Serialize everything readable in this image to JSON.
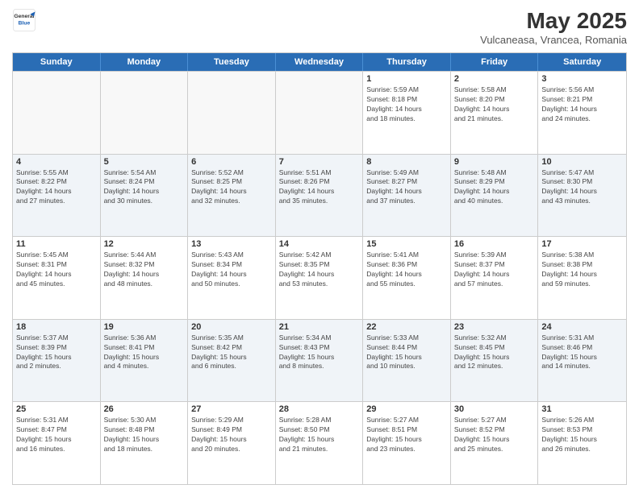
{
  "logo": {
    "general": "General",
    "blue": "Blue"
  },
  "title": "May 2025",
  "subtitle": "Vulcaneasa, Vrancea, Romania",
  "header_days": [
    "Sunday",
    "Monday",
    "Tuesday",
    "Wednesday",
    "Thursday",
    "Friday",
    "Saturday"
  ],
  "rows": [
    [
      {
        "day": "",
        "info": "",
        "empty": true
      },
      {
        "day": "",
        "info": "",
        "empty": true
      },
      {
        "day": "",
        "info": "",
        "empty": true
      },
      {
        "day": "",
        "info": "",
        "empty": true
      },
      {
        "day": "1",
        "info": "Sunrise: 5:59 AM\nSunset: 8:18 PM\nDaylight: 14 hours\nand 18 minutes.",
        "empty": false
      },
      {
        "day": "2",
        "info": "Sunrise: 5:58 AM\nSunset: 8:20 PM\nDaylight: 14 hours\nand 21 minutes.",
        "empty": false
      },
      {
        "day": "3",
        "info": "Sunrise: 5:56 AM\nSunset: 8:21 PM\nDaylight: 14 hours\nand 24 minutes.",
        "empty": false
      }
    ],
    [
      {
        "day": "4",
        "info": "Sunrise: 5:55 AM\nSunset: 8:22 PM\nDaylight: 14 hours\nand 27 minutes.",
        "empty": false
      },
      {
        "day": "5",
        "info": "Sunrise: 5:54 AM\nSunset: 8:24 PM\nDaylight: 14 hours\nand 30 minutes.",
        "empty": false
      },
      {
        "day": "6",
        "info": "Sunrise: 5:52 AM\nSunset: 8:25 PM\nDaylight: 14 hours\nand 32 minutes.",
        "empty": false
      },
      {
        "day": "7",
        "info": "Sunrise: 5:51 AM\nSunset: 8:26 PM\nDaylight: 14 hours\nand 35 minutes.",
        "empty": false
      },
      {
        "day": "8",
        "info": "Sunrise: 5:49 AM\nSunset: 8:27 PM\nDaylight: 14 hours\nand 37 minutes.",
        "empty": false
      },
      {
        "day": "9",
        "info": "Sunrise: 5:48 AM\nSunset: 8:29 PM\nDaylight: 14 hours\nand 40 minutes.",
        "empty": false
      },
      {
        "day": "10",
        "info": "Sunrise: 5:47 AM\nSunset: 8:30 PM\nDaylight: 14 hours\nand 43 minutes.",
        "empty": false
      }
    ],
    [
      {
        "day": "11",
        "info": "Sunrise: 5:45 AM\nSunset: 8:31 PM\nDaylight: 14 hours\nand 45 minutes.",
        "empty": false
      },
      {
        "day": "12",
        "info": "Sunrise: 5:44 AM\nSunset: 8:32 PM\nDaylight: 14 hours\nand 48 minutes.",
        "empty": false
      },
      {
        "day": "13",
        "info": "Sunrise: 5:43 AM\nSunset: 8:34 PM\nDaylight: 14 hours\nand 50 minutes.",
        "empty": false
      },
      {
        "day": "14",
        "info": "Sunrise: 5:42 AM\nSunset: 8:35 PM\nDaylight: 14 hours\nand 53 minutes.",
        "empty": false
      },
      {
        "day": "15",
        "info": "Sunrise: 5:41 AM\nSunset: 8:36 PM\nDaylight: 14 hours\nand 55 minutes.",
        "empty": false
      },
      {
        "day": "16",
        "info": "Sunrise: 5:39 AM\nSunset: 8:37 PM\nDaylight: 14 hours\nand 57 minutes.",
        "empty": false
      },
      {
        "day": "17",
        "info": "Sunrise: 5:38 AM\nSunset: 8:38 PM\nDaylight: 14 hours\nand 59 minutes.",
        "empty": false
      }
    ],
    [
      {
        "day": "18",
        "info": "Sunrise: 5:37 AM\nSunset: 8:39 PM\nDaylight: 15 hours\nand 2 minutes.",
        "empty": false
      },
      {
        "day": "19",
        "info": "Sunrise: 5:36 AM\nSunset: 8:41 PM\nDaylight: 15 hours\nand 4 minutes.",
        "empty": false
      },
      {
        "day": "20",
        "info": "Sunrise: 5:35 AM\nSunset: 8:42 PM\nDaylight: 15 hours\nand 6 minutes.",
        "empty": false
      },
      {
        "day": "21",
        "info": "Sunrise: 5:34 AM\nSunset: 8:43 PM\nDaylight: 15 hours\nand 8 minutes.",
        "empty": false
      },
      {
        "day": "22",
        "info": "Sunrise: 5:33 AM\nSunset: 8:44 PM\nDaylight: 15 hours\nand 10 minutes.",
        "empty": false
      },
      {
        "day": "23",
        "info": "Sunrise: 5:32 AM\nSunset: 8:45 PM\nDaylight: 15 hours\nand 12 minutes.",
        "empty": false
      },
      {
        "day": "24",
        "info": "Sunrise: 5:31 AM\nSunset: 8:46 PM\nDaylight: 15 hours\nand 14 minutes.",
        "empty": false
      }
    ],
    [
      {
        "day": "25",
        "info": "Sunrise: 5:31 AM\nSunset: 8:47 PM\nDaylight: 15 hours\nand 16 minutes.",
        "empty": false
      },
      {
        "day": "26",
        "info": "Sunrise: 5:30 AM\nSunset: 8:48 PM\nDaylight: 15 hours\nand 18 minutes.",
        "empty": false
      },
      {
        "day": "27",
        "info": "Sunrise: 5:29 AM\nSunset: 8:49 PM\nDaylight: 15 hours\nand 20 minutes.",
        "empty": false
      },
      {
        "day": "28",
        "info": "Sunrise: 5:28 AM\nSunset: 8:50 PM\nDaylight: 15 hours\nand 21 minutes.",
        "empty": false
      },
      {
        "day": "29",
        "info": "Sunrise: 5:27 AM\nSunset: 8:51 PM\nDaylight: 15 hours\nand 23 minutes.",
        "empty": false
      },
      {
        "day": "30",
        "info": "Sunrise: 5:27 AM\nSunset: 8:52 PM\nDaylight: 15 hours\nand 25 minutes.",
        "empty": false
      },
      {
        "day": "31",
        "info": "Sunrise: 5:26 AM\nSunset: 8:53 PM\nDaylight: 15 hours\nand 26 minutes.",
        "empty": false
      }
    ]
  ]
}
